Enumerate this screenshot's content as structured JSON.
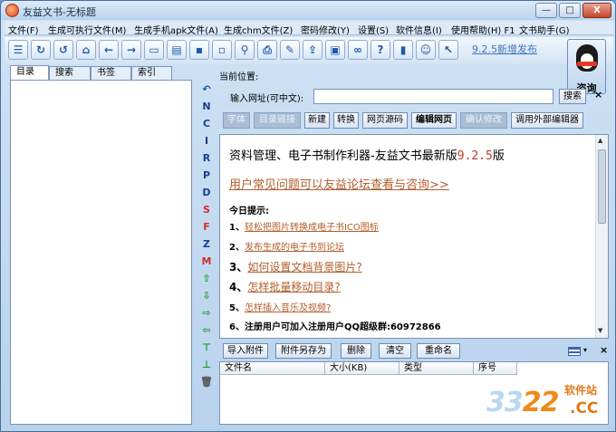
{
  "window": {
    "title": "友益文书-无标题",
    "min": "—",
    "max": "□",
    "close": "X"
  },
  "menu": [
    "文件(F)",
    "生成可执行文件(M)",
    "生成手机apk文件(A)",
    "生成chm文件(Z)",
    "密码修改(Y)",
    "设置(S)",
    "软件信息(I)",
    "使用帮助(H) F1",
    "文书助手(G)"
  ],
  "toolbar": {
    "icons": [
      "outline-icon",
      "refresh-icon",
      "reload-icon",
      "home-icon",
      "back-icon",
      "forward-icon",
      "new-document-icon",
      "open-folder-icon",
      "save-icon",
      "save-as-icon",
      "find-icon",
      "print-icon",
      "edit-icon",
      "export-icon",
      "compile-icon",
      "link-icon",
      "help-icon",
      "book-icon",
      "smiley-icon",
      "pointer-icon"
    ],
    "glyphs": [
      "☰",
      "↻",
      "↺",
      "⌂",
      "←",
      "→",
      "▭",
      "▤",
      "▪",
      "▫",
      "⚲",
      "⎙",
      "✎",
      "⇪",
      "▣",
      "∞",
      "?",
      "▮",
      "☺",
      "↖"
    ],
    "news": "9.2.5新增发布"
  },
  "qq": {
    "label": "咨询"
  },
  "left": {
    "tabs": [
      "目录",
      "搜索",
      "书签",
      "索引"
    ],
    "strip": [
      {
        "t": "↶",
        "name": "undo-arrow-icon",
        "c": "#1d4fb0"
      },
      {
        "t": "N",
        "name": "strip-n",
        "c": "#1a3f8c"
      },
      {
        "t": "C",
        "name": "strip-c",
        "c": "#1a3f8c"
      },
      {
        "t": "I",
        "name": "strip-i",
        "c": "#1a3f8c"
      },
      {
        "t": "R",
        "name": "strip-r",
        "c": "#1a3f8c"
      },
      {
        "t": "P",
        "name": "strip-p",
        "c": "#1a3f8c"
      },
      {
        "t": "D",
        "name": "strip-d",
        "c": "#1a3f8c"
      },
      {
        "t": "S",
        "name": "strip-s",
        "c": "#d32f2f"
      },
      {
        "t": "F",
        "name": "strip-f",
        "c": "#d32f2f"
      },
      {
        "t": "Z",
        "name": "strip-z",
        "c": "#1a3f8c"
      },
      {
        "t": "M",
        "name": "strip-m",
        "c": "#d32f2f"
      },
      {
        "t": "⇧",
        "name": "move-up-icon",
        "c": "#1e9a3a"
      },
      {
        "t": "⇩",
        "name": "move-down-icon",
        "c": "#1e9a3a"
      },
      {
        "t": "⇨",
        "name": "move-right-icon",
        "c": "#1e9a3a"
      },
      {
        "t": "⇦",
        "name": "move-left-icon",
        "c": "#1e9a3a"
      },
      {
        "t": "⊤",
        "name": "move-top-icon",
        "c": "#1e9a3a"
      },
      {
        "t": "⊥",
        "name": "move-bottom-icon",
        "c": "#1e9a3a"
      },
      {
        "t": "🗑",
        "name": "trash-icon",
        "c": "#555"
      }
    ]
  },
  "right": {
    "location_label": "当前位置:",
    "url_label": "输入网址(可中文):",
    "url_value": "",
    "search_label": "搜索",
    "buttons": [
      {
        "label": "字体",
        "dis": true,
        "bold": false
      },
      {
        "label": "目录链接",
        "dis": true,
        "bold": false
      },
      {
        "label": "新建",
        "dis": false,
        "bold": false
      },
      {
        "label": "转换",
        "dis": false,
        "bold": false
      },
      {
        "label": "网页源码",
        "dis": false,
        "bold": false
      },
      {
        "label": "编辑网页",
        "dis": false,
        "bold": true
      },
      {
        "label": "确认修改",
        "dis": true,
        "bold": false
      },
      {
        "label": "调用外部编辑器",
        "dis": false,
        "bold": false
      }
    ]
  },
  "content": {
    "headline": "资料管理、电子书制作利器-友益文书最新版",
    "version": "9.2.5",
    "headline_suffix": "版",
    "faq": "用户常见问题可以友益论坛查看与咨询>>",
    "tips_title": "今日提示:",
    "tips": [
      {
        "num": "1、",
        "text": "轻松把图片转换成电子书ICO图标",
        "size": 10
      },
      {
        "num": "2、",
        "text": "发布生成的电子书到论坛",
        "size": 10
      },
      {
        "num": "3、",
        "text": "如何设置文档背景图片?",
        "size": 12
      },
      {
        "num": "4、",
        "text": "怎样批量移动目录?",
        "size": 12
      },
      {
        "num": "5、",
        "text": "怎样插入音乐及视频?",
        "size": 10
      },
      {
        "num": "6、",
        "text": "注册用户可加入注册用户QQ超级群:60972866",
        "size": 10
      }
    ]
  },
  "attachments": {
    "buttons": [
      "导入附件",
      "附件另存为",
      "删除",
      "清空",
      "重命名"
    ],
    "columns": [
      "文件名",
      "大小(KB)",
      "类型",
      "序号"
    ],
    "close": "×",
    "dropdown": "▾"
  },
  "watermark": {
    "big1": "33",
    "big2": "22",
    "site": "软件站",
    "domain": ".CC"
  }
}
